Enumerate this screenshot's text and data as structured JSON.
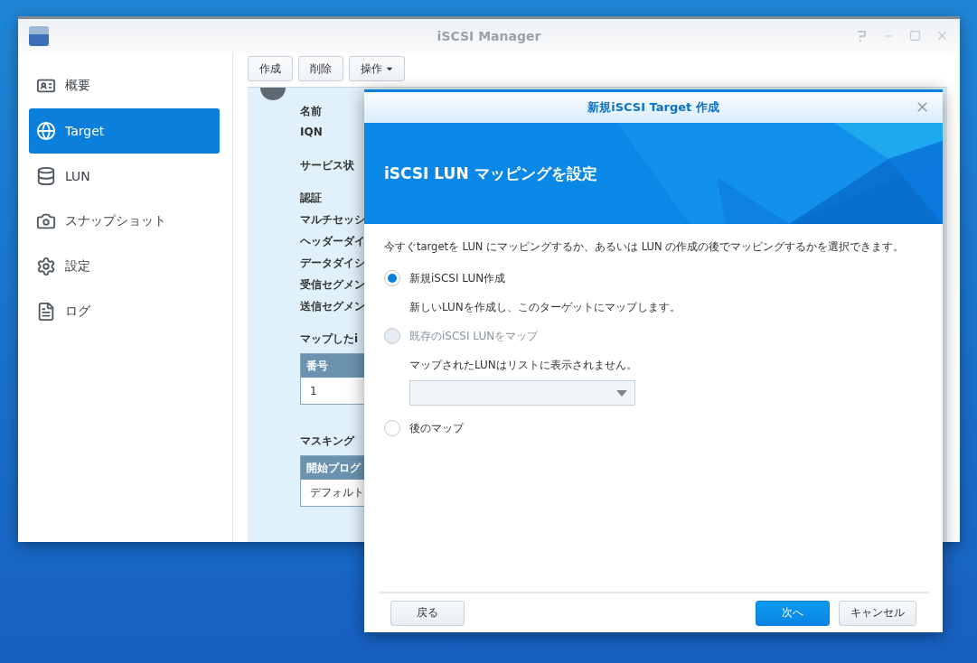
{
  "window": {
    "title": "iSCSI Manager"
  },
  "sidebar": {
    "items": [
      {
        "label": "概要",
        "selected": false
      },
      {
        "label": "Target",
        "selected": true
      },
      {
        "label": "LUN",
        "selected": false
      },
      {
        "label": "スナップショット",
        "selected": false
      },
      {
        "label": "設定",
        "selected": false
      },
      {
        "label": "ログ",
        "selected": false
      }
    ]
  },
  "toolbar": {
    "buttons": [
      {
        "label": "作成",
        "kind": "plain"
      },
      {
        "label": "削除",
        "kind": "plain"
      },
      {
        "label": "操作",
        "kind": "menu"
      }
    ]
  },
  "details": {
    "groups": [
      [
        "名前",
        "IQN"
      ],
      [
        "サービス状"
      ],
      [
        "認証",
        "マルチセッシ",
        "ヘッダーダイ",
        "データダイシ",
        "受信セグメン",
        "送信セグメン"
      ]
    ],
    "sections": [
      {
        "title": "マップしたi",
        "column": "番号",
        "cell": "1"
      },
      {
        "title": "マスキング",
        "column": "開始プログ",
        "cell": "デフォルト"
      }
    ]
  },
  "dialog": {
    "title": "新規iSCSI Target 作成",
    "heading": "iSCSI LUN マッピングを設定",
    "description": "今すぐtargetを LUN にマッピングするか、あるいは LUN の作成の後でマッピングするかを選択できます。",
    "options": [
      {
        "label": "新規iSCSI LUN作成",
        "selected": true,
        "disabled": false,
        "kind": "note",
        "note": "新しいLUNを作成し、このターゲットにマップします。"
      },
      {
        "label": "既存のiSCSI LUNをマップ",
        "selected": false,
        "disabled": true,
        "kind": "select",
        "note": "マップされたLUNはリストに表示されません。"
      },
      {
        "label": "後のマップ",
        "selected": false,
        "disabled": false,
        "kind": "plain"
      }
    ],
    "footer": {
      "left": [
        {
          "label": "戻る",
          "kind": "secondary"
        }
      ],
      "right": [
        {
          "label": "次へ",
          "kind": "primary"
        },
        {
          "label": "キャンセル",
          "kind": "secondary"
        }
      ]
    }
  }
}
